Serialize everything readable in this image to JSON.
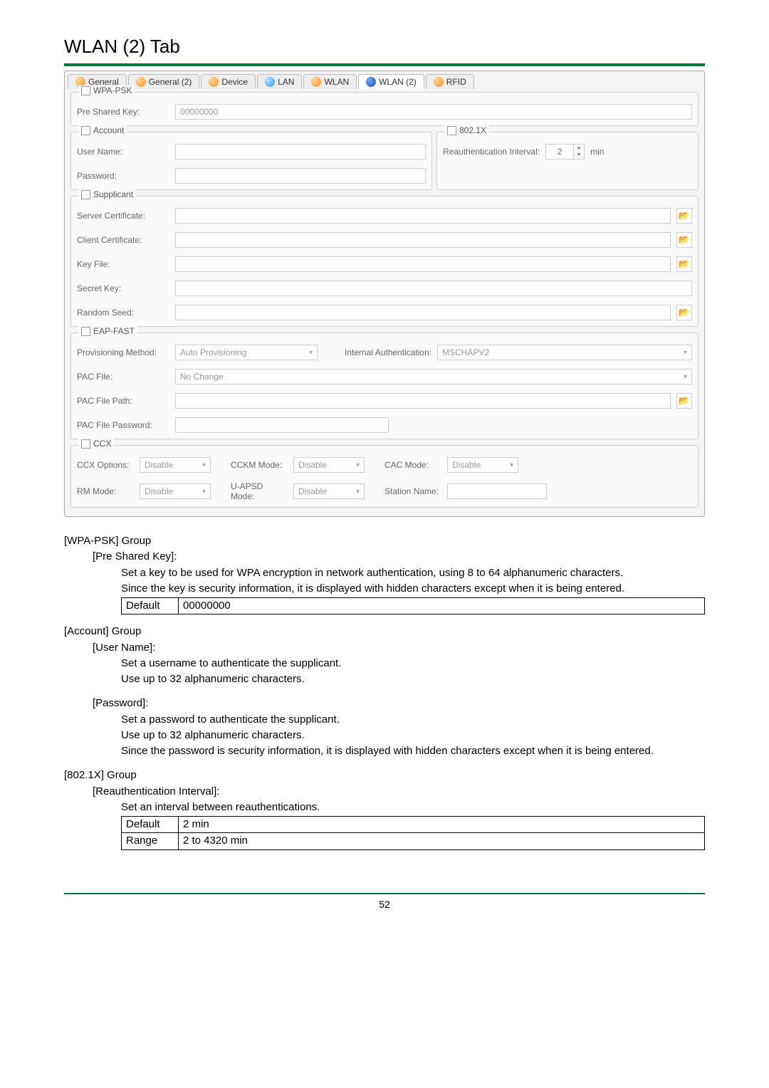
{
  "title": "WLAN (2) Tab",
  "tabs": [
    "General",
    "General (2)",
    "Device",
    "LAN",
    "WLAN",
    "WLAN (2)",
    "RFID"
  ],
  "wpapsk": {
    "group_label": "WPA-PSK",
    "psk_label": "Pre Shared Key:",
    "psk_value": "00000000"
  },
  "account": {
    "group_label": "Account",
    "user_label": "User Name:",
    "pass_label": "Password:"
  },
  "dot1x": {
    "group_label": "802.1X",
    "reauth_label": "Reauthentication Interval:",
    "reauth_value": "2",
    "unit": "min"
  },
  "supplicant": {
    "group_label": "Supplicant",
    "server_cert": "Server Certificate:",
    "client_cert": "Client Certificate:",
    "key_file": "Key File:",
    "secret_key": "Secret Key:",
    "random_seed": "Random Seed:"
  },
  "eapfast": {
    "group_label": "EAP-FAST",
    "prov_label": "Provisioning Method:",
    "prov_value": "Auto Provisioning",
    "intauth_label": "Internal Authentication:",
    "intauth_value": "MSCHAPV2",
    "pacfile_label": "PAC File:",
    "pacfile_value": "No Change",
    "pacpath_label": "PAC File Path:",
    "pacpw_label": "PAC File Password:"
  },
  "ccx": {
    "group_label": "CCX",
    "opts_label": "CCX Options:",
    "opts_value": "Disable",
    "cckm_label": "CCKM Mode:",
    "cckm_value": "Disable",
    "cac_label": "CAC Mode:",
    "cac_value": "Disable",
    "rm_label": "RM Mode:",
    "rm_value": "Disable",
    "uapsd_label": "U-APSD Mode:",
    "uapsd_value": "Disable",
    "station_label": "Station Name:"
  },
  "doc": {
    "wpapsk_group": "[WPA-PSK] Group",
    "psk_h": "[Pre Shared Key]:",
    "psk_p1": "Set a key to be used for WPA encryption in network authentication, using 8 to 64 alphanumeric characters.",
    "psk_p2": "Since the key is security information, it is displayed with hidden characters except when it is being entered.",
    "psk_default_label": "Default",
    "psk_default_value": "00000000",
    "account_group": "[Account] Group",
    "user_h": "[User Name]:",
    "user_p1": "Set a username to authenticate the supplicant.",
    "user_p2": "Use up to 32 alphanumeric characters.",
    "pass_h": "[Password]:",
    "pass_p1": "Set a password to authenticate the supplicant.",
    "pass_p2": "Use up to 32 alphanumeric characters.",
    "pass_p3": "Since the password is security information, it is displayed with hidden characters except when it is being entered.",
    "dot1x_group": "[802.1X] Group",
    "reauth_h": "[Reauthentication Interval]:",
    "reauth_p": "Set an interval between reauthentications.",
    "reauth_default_label": "Default",
    "reauth_default_value": "2 min",
    "reauth_range_label": "Range",
    "reauth_range_value": "2 to 4320 min"
  },
  "page_number": "52"
}
